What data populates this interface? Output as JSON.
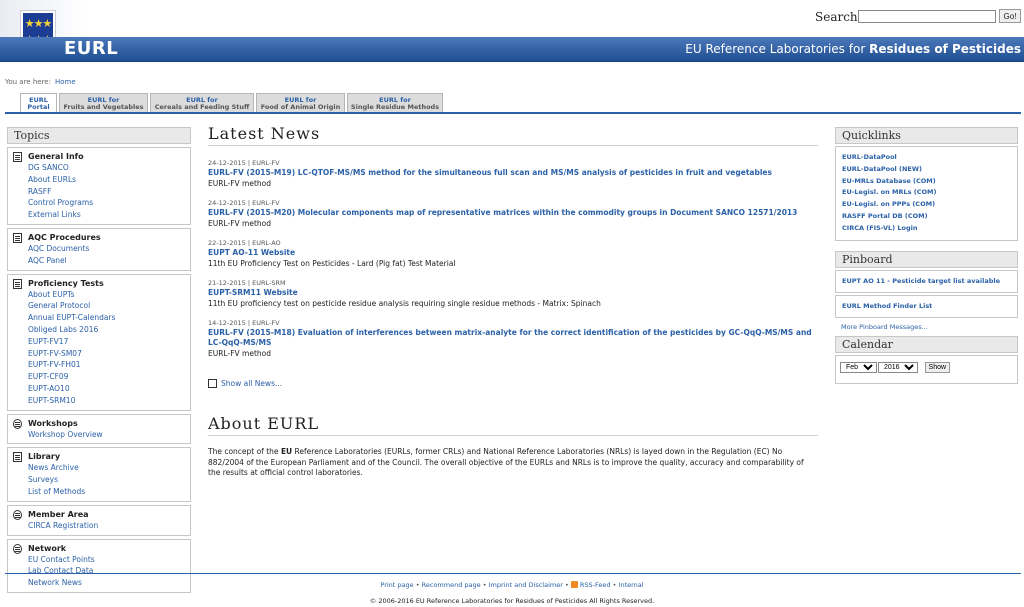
{
  "header": {
    "eu_logo_caption": "European Commission",
    "search_label": "Search:",
    "search_value": "",
    "go_label": "Go!",
    "logo_text": "EURL",
    "site_title_prefix": "EU Reference Laboratories for",
    "site_title_bold": "Residues of Pesticides"
  },
  "breadcrumb": {
    "label": "You are here:",
    "home": "Home"
  },
  "tabs": [
    {
      "l1": "EURL",
      "l2": "Portal"
    },
    {
      "l1": "EURL for",
      "l2": "Fruits and Vegetables"
    },
    {
      "l1": "EURL for",
      "l2": "Cereals and Feeding Stuff"
    },
    {
      "l1": "EURL for",
      "l2": "Food of Animal Origin"
    },
    {
      "l1": "EURL for",
      "l2": "Single Residue Methods"
    }
  ],
  "topics": {
    "title": "Topics",
    "groups": [
      {
        "title": "General Info",
        "links": [
          "DG SANCO",
          "About EURLs",
          "RASFF",
          "Control Programs",
          "External Links"
        ]
      },
      {
        "title": "AQC Procedures",
        "links": [
          "AQC Documents",
          "AQC Panel"
        ]
      },
      {
        "title": "Proficiency Tests",
        "links": [
          "About EUPTs",
          "General Protocol",
          "Annual EUPT-Calendars",
          "Obliged Labs 2016",
          "EUPT-FV17",
          "EUPT-FV-SM07",
          "EUPT-FV-FH01",
          "EUPT-CF09",
          "EUPT-AO10",
          "EUPT-SRM10"
        ]
      },
      {
        "title": "Workshops",
        "links": [
          "Workshop Overview"
        ]
      },
      {
        "title": "Library",
        "links": [
          "News Archive",
          "Surveys",
          "List of Methods"
        ]
      },
      {
        "title": "Member Area",
        "links": [
          "CIRCA Registration"
        ]
      },
      {
        "title": "Network",
        "links": [
          "EU Contact Points",
          "Lab Contact Data",
          "Network News"
        ]
      }
    ]
  },
  "news": {
    "title": "Latest News",
    "items": [
      {
        "meta": "24-12-2015 | EURL-FV",
        "title": "EURL-FV (2015-M19) LC-QTOF-MS/MS method for the simultaneous full scan and MS/MS analysis of pesticides in fruit and vegetables",
        "sub": "EURL-FV method"
      },
      {
        "meta": "24-12-2015 | EURL-FV",
        "title": "EURL-FV (2015-M20) Molecular components map of representative matrices within the commodity groups in Document SANCO 12571/2013",
        "sub": "EURL-FV method"
      },
      {
        "meta": "22-12-2015 | EURL-AO",
        "title": "EUPT AO-11 Website",
        "sub": "11th EU Proficiency Test on Pesticides - Lard (Pig fat) Test Material"
      },
      {
        "meta": "21-12-2015 | EURL-SRM",
        "title": "EUPT-SRM11 Website",
        "sub": "11th EU proficiency test on pesticide residue analysis requiring single residue methods - Matrix: Spinach"
      },
      {
        "meta": "14-12-2015 | EURL-FV",
        "title": "EURL-FV (2015-M18) Evaluation of interferences between matrix-analyte for the correct identification of the pesticides by GC-QqQ-MS/MS and LC-QqQ-MS/MS",
        "sub": "EURL-FV method"
      }
    ],
    "show_all": "Show all News..."
  },
  "about": {
    "title": "About EURL",
    "text_before": "The concept of the ",
    "text_bold": "EU",
    "text_after": " Reference Laboratories (EURLs, former CRLs) and National Reference Laboratories (NRLs) is layed down in the Regulation (EC) No 882/2004 of the European Parliament and of the Council. The overall objective of the EURLs and NRLs is to improve the quality, accuracy and comparability of the results at official control laboratories."
  },
  "quicklinks": {
    "title": "Quicklinks",
    "links": [
      "EURL-DataPool",
      "EURL-DataPool (NEW)",
      "EU-MRLs Database (COM)",
      "EU-Legisl. on MRLs (COM)",
      "EU-Legisl. on PPPs (COM)",
      "RASFF Portal DB (COM)",
      "CIRCA (FIS-VL) Login"
    ]
  },
  "pinboard": {
    "title": "Pinboard",
    "items": [
      "EUPT AO 11 - Pesticide target list available",
      "EURL Method Finder List"
    ],
    "more": "More Pinboard Messages..."
  },
  "calendar": {
    "title": "Calendar",
    "month": "Feb",
    "year": "2016",
    "show_label": "Show"
  },
  "footer": {
    "links": [
      "Print page",
      "Recommend page",
      "Imprint and Disclaimer",
      "RSS-Feed",
      "Internal"
    ],
    "separator": "•",
    "copyright": "© 2006-2016 EU Reference Laboratories for Residues of Pesticides All Rights Reserved."
  },
  "colors": {
    "banner": "#1f4e92",
    "link": "#2b61a8",
    "box_border": "#c7c7c7"
  }
}
